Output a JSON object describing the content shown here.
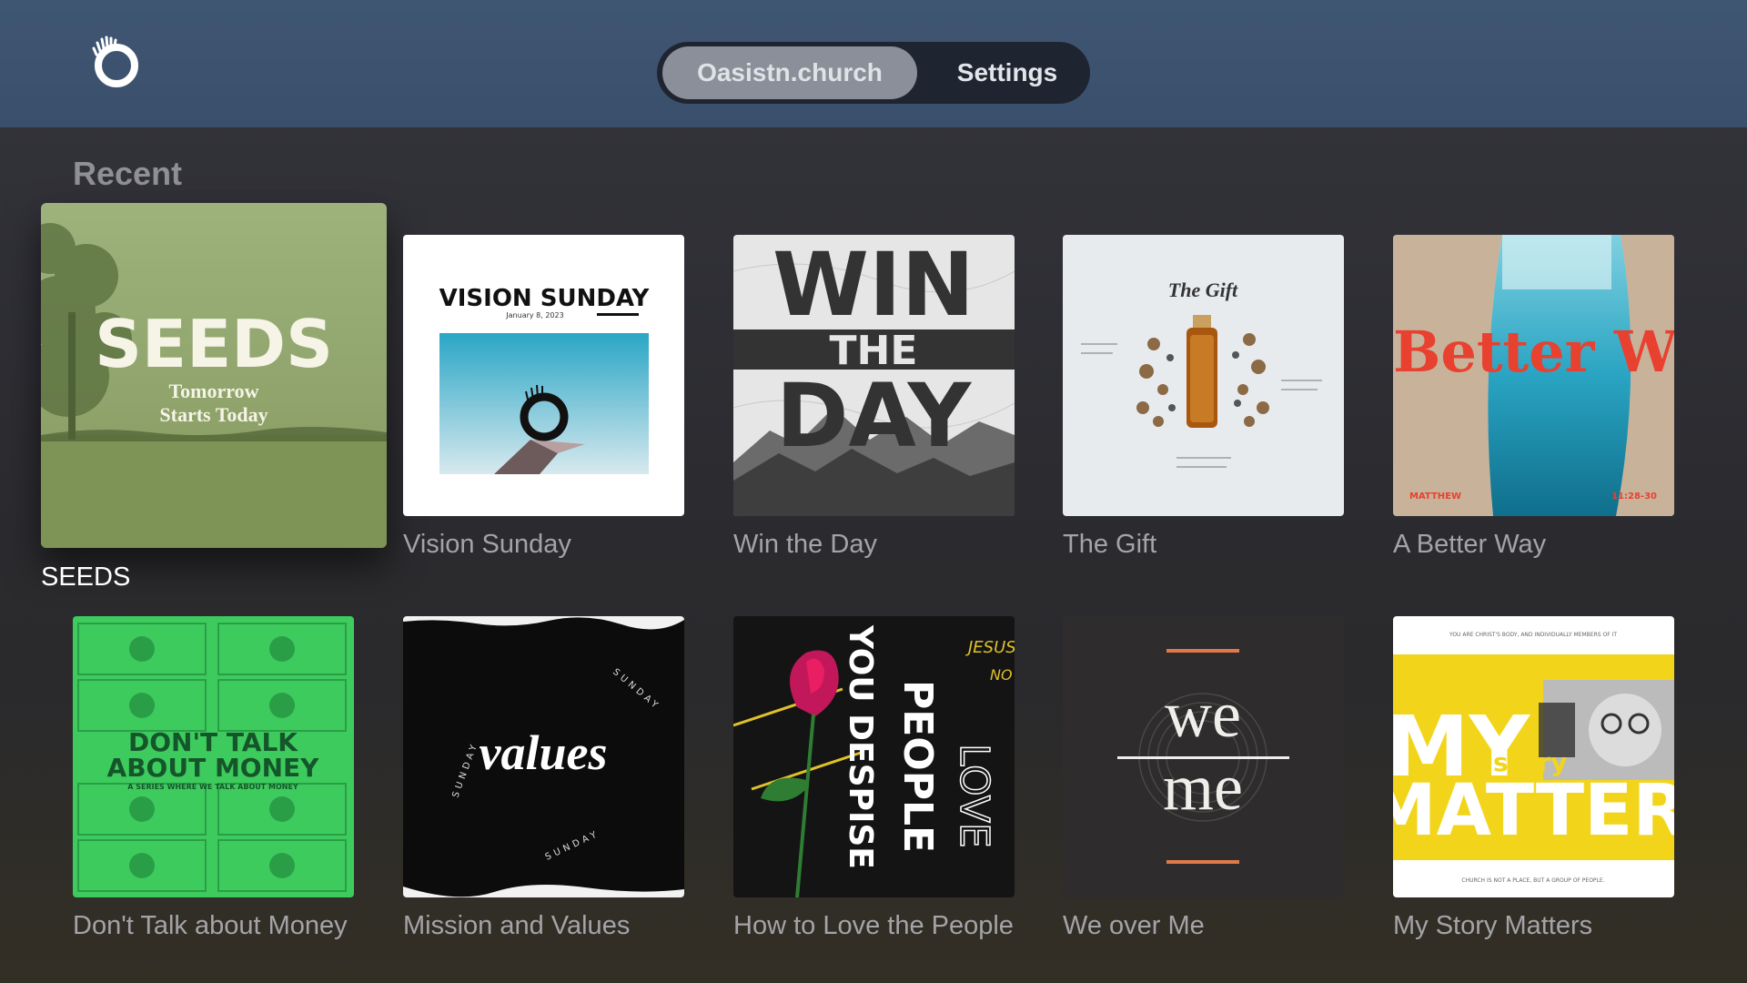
{
  "header": {
    "logo_icon": "oasis-church-logo-icon",
    "tabs": [
      {
        "label": "Oasistn.church",
        "active": true
      },
      {
        "label": "Settings",
        "active": false
      }
    ]
  },
  "recent": {
    "title": "Recent",
    "items": [
      {
        "title": "SEEDS",
        "focused": true,
        "art": {
          "headline": "SEEDS",
          "sub1": "Tomorrow",
          "sub2": "Starts Today"
        }
      },
      {
        "title": "Vision Sunday",
        "art": {
          "headline": "VISION SUNDAY",
          "date": "January 8, 2023"
        }
      },
      {
        "title": "Win the Day",
        "art": {
          "line1": "WIN",
          "line2": "THE",
          "line3": "DAY"
        }
      },
      {
        "title": "The Gift",
        "art": {
          "headline": "The Gift"
        }
      },
      {
        "title": "A Better Way",
        "art": {
          "headline": "Better Wa",
          "left": "MATTHEW",
          "right": "11:28-30"
        }
      },
      {
        "title": "Don't Talk about Money",
        "art": {
          "line1": "DON'T TALK",
          "line2": "ABOUT MONEY",
          "line3": "A SERIES WHERE WE TALK ABOUT MONEY"
        }
      },
      {
        "title": "Mission and Values",
        "art": {
          "headline": "values",
          "ring": "SUNDAY"
        }
      },
      {
        "title": "How to Love the People You Despise",
        "art": {
          "col1": "YOU DESPISE",
          "col2": "PEOPLE",
          "col3": "LOVE",
          "tag1": "JESUS",
          "tag2": "NO"
        }
      },
      {
        "title": "We over Me",
        "art": {
          "top": "we",
          "bottom": "me"
        }
      },
      {
        "title": "My Story Matters",
        "art": {
          "line1": "MY",
          "story": "story",
          "line2": "MATTER",
          "top_text": "YOU ARE CHRIST'S BODY, AND INDIVIDUALLY MEMBERS OF IT",
          "bottom_text": "CHURCH IS NOT A PLACE, BUT A GROUP OF PEOPLE."
        }
      }
    ]
  },
  "colors": {
    "header_bg": "#3d5470",
    "tab_active_bg": "#8a8f99",
    "seeds_green": "#8fa36b",
    "better_way_red": "#e8412f",
    "money_green": "#3ecb5e",
    "story_yellow": "#f2d51b"
  }
}
